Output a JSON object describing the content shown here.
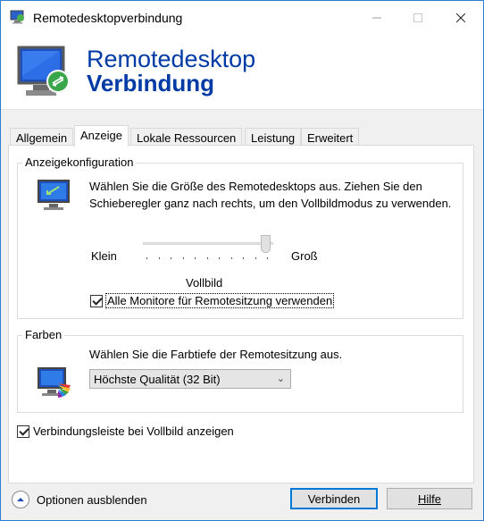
{
  "window": {
    "title": "Remotedesktopverbindung",
    "icon": "remote-desktop-icon",
    "controls": {
      "minimize": "minimize-icon",
      "maximize": "maximize-icon",
      "close": "close-icon"
    }
  },
  "banner": {
    "line1": "Remotedesktop",
    "line2": "Verbindung",
    "color": "#003aa5"
  },
  "tabs": [
    {
      "label": "Allgemein",
      "active": false
    },
    {
      "label": "Anzeige",
      "active": true
    },
    {
      "label": "Lokale Ressourcen",
      "active": false
    },
    {
      "label": "Leistung",
      "active": false
    },
    {
      "label": "Erweitert",
      "active": false
    }
  ],
  "display_config": {
    "group_title": "Anzeigekonfiguration",
    "description": "Wählen Sie die Größe des Remotedesktops aus. Ziehen Sie den Schieberegler ganz nach rechts, um den Vollbildmodus zu verwenden.",
    "slider": {
      "min_label": "Klein",
      "max_label": "Groß",
      "value_label": "Vollbild",
      "position_fraction": 1.0
    },
    "multi_monitor": {
      "label": "Alle Monitore für Remotesitzung verwenden",
      "checked": true
    }
  },
  "colors": {
    "group_title": "Farben",
    "description": "Wählen Sie die Farbtiefe der Remotesitzung aus.",
    "selected": "Höchste Qualität (32 Bit)"
  },
  "connection_bar": {
    "label": "Verbindungsleiste bei Vollbild anzeigen",
    "checked": true
  },
  "footer": {
    "options_label": "Optionen ausblenden",
    "connect_label": "Verbinden",
    "help_label": "Hilfe",
    "accent": "#0078d7"
  }
}
